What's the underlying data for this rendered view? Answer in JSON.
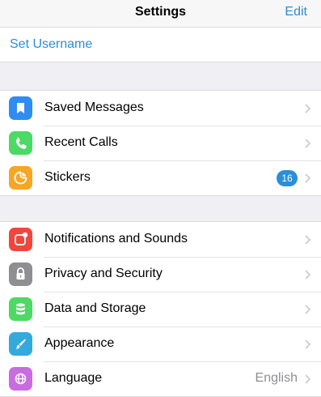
{
  "navbar": {
    "title": "Settings",
    "edit_label": "Edit"
  },
  "profile": {
    "set_username_label": "Set Username"
  },
  "groups": [
    {
      "items": [
        {
          "label": "Saved Messages",
          "icon": "bookmark-icon",
          "icon_color": "#2f8cf0"
        },
        {
          "label": "Recent Calls",
          "icon": "phone-icon",
          "icon_color": "#4cd964"
        },
        {
          "label": "Stickers",
          "icon": "sticker-icon",
          "icon_color": "#f5a623",
          "badge": "16"
        }
      ]
    },
    {
      "items": [
        {
          "label": "Notifications and Sounds",
          "icon": "notification-icon",
          "icon_color": "#f1453d"
        },
        {
          "label": "Privacy and Security",
          "icon": "lock-icon",
          "icon_color": "#8e8e93"
        },
        {
          "label": "Data and Storage",
          "icon": "database-icon",
          "icon_color": "#4cd964"
        },
        {
          "label": "Appearance",
          "icon": "brush-icon",
          "icon_color": "#34aadc"
        },
        {
          "label": "Language",
          "icon": "globe-icon",
          "icon_color": "#c86ce0",
          "value": "English"
        }
      ]
    }
  ],
  "colors": {
    "accent": "#2a8ed8",
    "background": "#efeff4",
    "separator": "#dcdce0",
    "secondary_text": "#8e8e93"
  }
}
